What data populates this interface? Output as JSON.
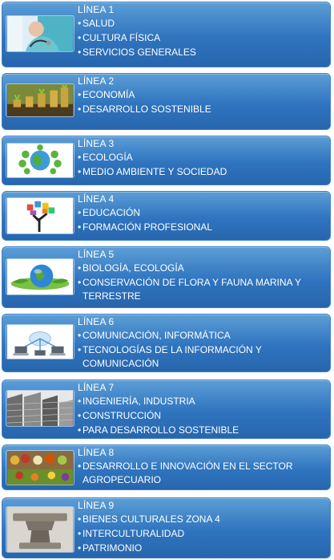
{
  "lineas": [
    {
      "title": "LÍNEA 1",
      "image": "doctor-stethoscope-image",
      "items": [
        "SALUD",
        "CULTURA FÍSICA",
        "SERVICIOS GENERALES"
      ]
    },
    {
      "title": "LÍNEA 2",
      "image": "coins-seedlings-image",
      "items": [
        "ECONOMÍA",
        "DESARROLLO SOSTENIBLE"
      ]
    },
    {
      "title": "LÍNEA 3",
      "image": "green-globe-image",
      "items": [
        "ECOLOGÍA",
        "MEDIO AMBIENTE Y SOCIEDAD"
      ]
    },
    {
      "title": "LÍNEA 4",
      "image": "education-tree-image",
      "items": [
        "EDUCACIÓN",
        "FORMACIÓN PROFESIONAL"
      ]
    },
    {
      "title": "LÍNEA 5",
      "image": "earth-leaves-image",
      "items": [
        "BIOLOGÍA, ECOLOGÍA",
        "CONSERVACIÓN DE FLORA Y FAUNA MARINA Y TERRESTRE"
      ]
    },
    {
      "title": "LÍNEA 6",
      "image": "network-laptops-image",
      "items": [
        "COMUNICACIÓN, INFORMÁTICA",
        "TECNOLOGÍAS DE LA INFORMACIÓN Y COMUNICACIÓN"
      ]
    },
    {
      "title": "LÍNEA 7",
      "image": "buildings-image",
      "items": [
        "INGENIERÍA, INDUSTRIA",
        "CONSTRUCCIÓN",
        "PARA DESARROLLO SOSTENIBLE"
      ]
    },
    {
      "title": "LÍNEA 8",
      "image": "produce-market-image",
      "items": [
        "DESARROLLO E INNOVACIÓN EN EL SECTOR AGROPECUARIO"
      ]
    },
    {
      "title": "LÍNEA 9",
      "image": "stone-altar-image",
      "items": [
        "BIENES CULTURALES ZONA 4",
        "INTERCULTURALIDAD",
        "PATRIMONIO"
      ]
    }
  ]
}
